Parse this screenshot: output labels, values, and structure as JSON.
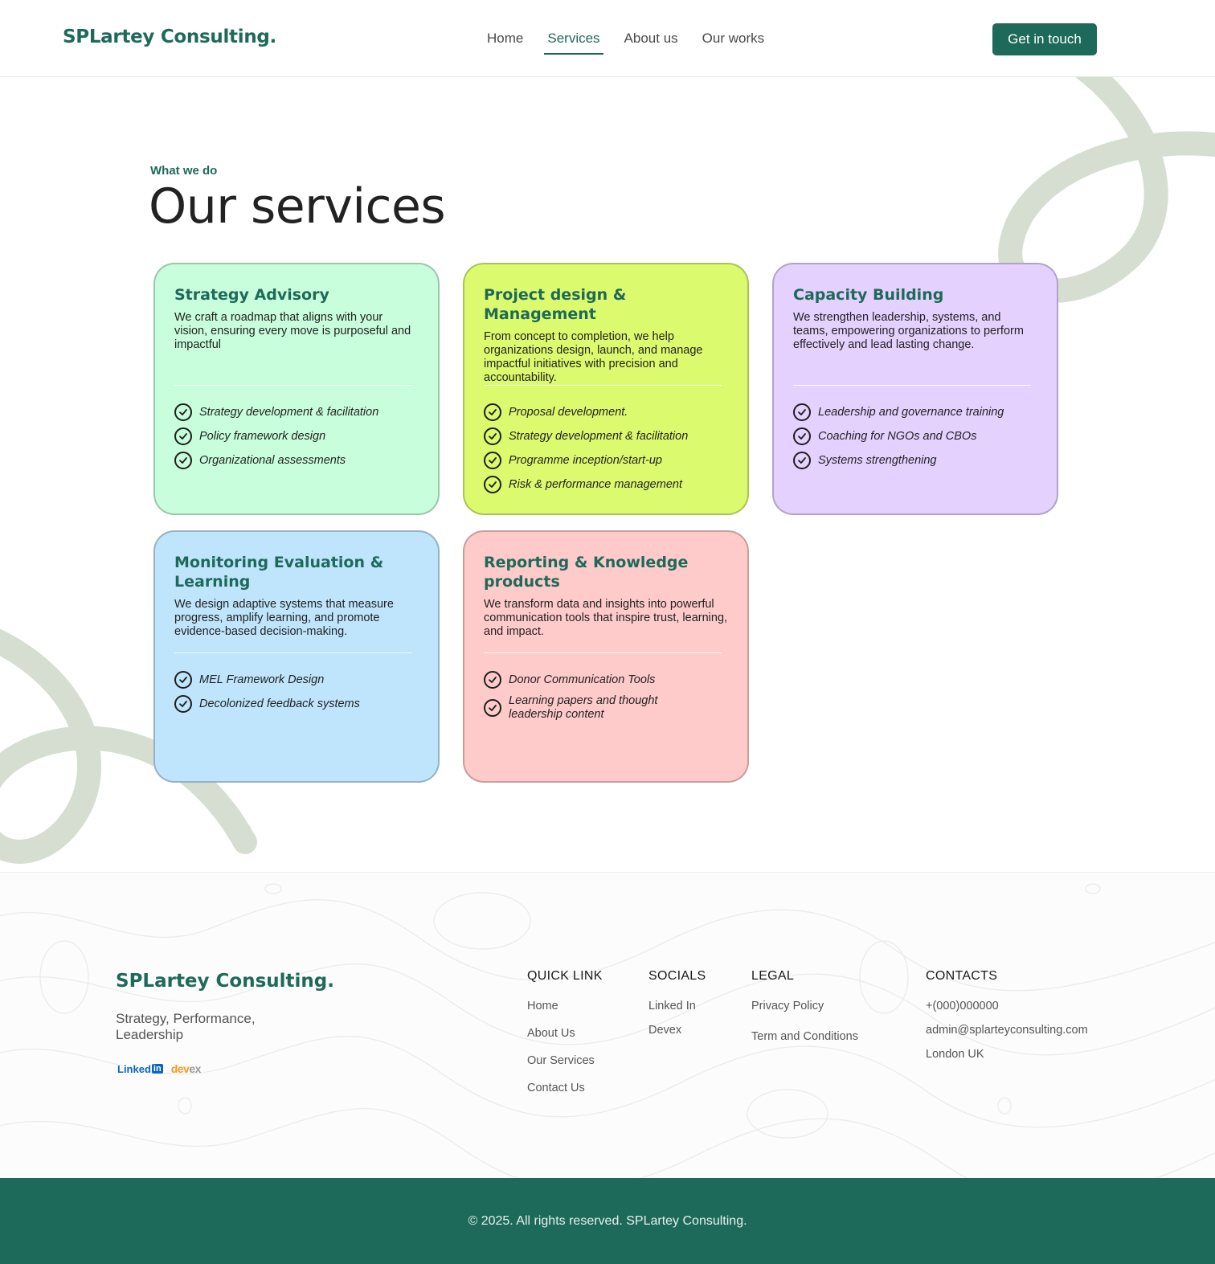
{
  "header": {
    "logo": "SPLartey Consulting.",
    "nav": [
      "Home",
      "Services",
      "About us",
      "Our works"
    ],
    "active_nav": "Services",
    "cta": "Get in touch"
  },
  "hero": {
    "eyebrow": "What we do",
    "title": "Our services"
  },
  "services": [
    {
      "title": "Strategy Advisory",
      "desc": "We craft a roadmap that aligns with your vision, ensuring every move is purposeful and impactful",
      "color": "#c8fedc",
      "items": [
        "Strategy development & facilitation",
        "Policy framework design",
        "Organizational assessments"
      ]
    },
    {
      "title": "Project design & Management",
      "desc": "From concept to completion, we help organizations design, launch, and manage impactful initiatives with precision and accountability.",
      "color": "#dcfa6d",
      "items": [
        "Proposal development.",
        "Strategy development & facilitation",
        "Programme inception/start-up",
        "Risk & performance management"
      ]
    },
    {
      "title": "Capacity Building",
      "desc": "We strengthen leadership, systems, and teams, empowering organizations to perform effectively and lead lasting change.",
      "color": "#e4d1fe",
      "items": [
        "Leadership and governance training",
        "Coaching for NGOs and CBOs",
        "Systems strengthening"
      ]
    },
    {
      "title": "Monitoring Evaluation & Learning",
      "desc": "We design adaptive systems that measure progress, amplify learning, and promote evidence-based decision-making.",
      "color": "#bfe5fc",
      "items": [
        "MEL Framework Design",
        "Decolonized feedback systems"
      ]
    },
    {
      "title": "Reporting & Knowledge products",
      "desc": "We transform data and insights into powerful communication tools that inspire trust, learning, and impact.",
      "color": "#fecbca",
      "items": [
        "Donor Communication Tools",
        "Learning papers and thought leadership content"
      ]
    }
  ],
  "footer": {
    "logo": "SPLartey Consulting.",
    "tagline": "Strategy, Performance, Leadership",
    "badges": {
      "linkedin": "Linked",
      "linkedin_in": "in",
      "devex_a": "dev",
      "devex_b": "ex"
    },
    "quick_link": {
      "heading": "QUICK LINK",
      "links": [
        "Home",
        "About Us",
        "Our Services",
        "Contact Us"
      ]
    },
    "socials": {
      "heading": "SOCIALS",
      "links": [
        "Linked In",
        "Devex"
      ]
    },
    "legal": {
      "heading": "LEGAL",
      "links": [
        "Privacy Policy",
        "Term and Conditions"
      ]
    },
    "contacts": {
      "heading": "CONTACTS",
      "lines": [
        "+(000)000000",
        "admin@splarteyconsulting.com",
        "London UK"
      ]
    }
  },
  "copyright": "© 2025. All rights reserved. SPLartey Consulting."
}
